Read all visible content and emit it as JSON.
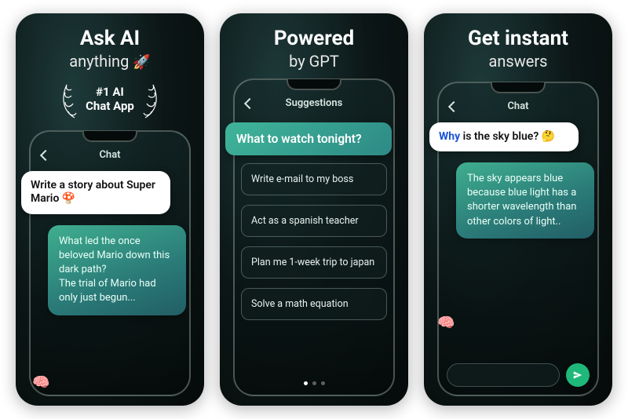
{
  "panel1": {
    "headline": "Ask AI",
    "subline": "anything",
    "rocket_emoji": "🚀",
    "badge_line1": "#1 AI",
    "badge_line2": "Chat App",
    "phone_title": "Chat",
    "user_bubble_prefix": "Write a story about ",
    "user_bubble_bold": "Super Mario",
    "user_bubble_emoji": "🍄",
    "ai_bubble": "What led the once beloved Mario down this dark path?\nThe trial of Mario had only just begun..."
  },
  "panel2": {
    "headline": "Powered",
    "subline": "by GPT",
    "phone_title": "Suggestions",
    "primary": "What to watch tonight?",
    "options": [
      "Write e-mail to my boss",
      "Act as a spanish teacher",
      "Plan me 1-week trip to japan",
      "Solve a math equation"
    ],
    "page_dots": {
      "count": 3,
      "active": 0
    }
  },
  "panel3": {
    "headline": "Get instant",
    "subline": "answers",
    "phone_title": "Chat",
    "user_bubble_highlight": "Why",
    "user_bubble_rest": " is the sky blue? ",
    "user_bubble_emoji": "🤔",
    "ai_bubble": "The sky appears blue because blue light has a shorter wavelength than other colors of light..",
    "input_placeholder": ""
  },
  "icons": {
    "brain": "🧠",
    "send": "send-icon",
    "back": "chevron-left-icon"
  },
  "colors": {
    "accent_green": "#2fb08b",
    "highlight_blue": "#1a56d6",
    "bg_dark": "#0c1616"
  }
}
